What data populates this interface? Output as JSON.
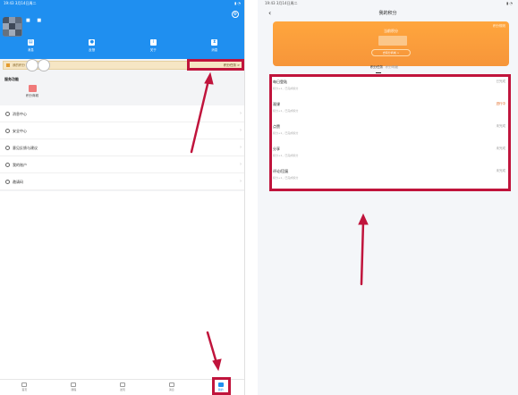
{
  "left": {
    "status": {
      "time": "19:43",
      "date": "3月14日周二"
    },
    "profile": {
      "name": "■ ■",
      "sub": ""
    },
    "quick": [
      {
        "label": "消息",
        "icon": "folder-icon"
      },
      {
        "label": "反馈",
        "icon": "chat-icon"
      },
      {
        "label": "关于",
        "icon": "info-icon"
      },
      {
        "label": "消息",
        "icon": "hourglass-icon"
      }
    ],
    "points_bar": {
      "text": "我的积分",
      "link": "积分任务 >"
    },
    "service_title": "服务功能",
    "service_item": "积分商城",
    "menu": [
      "消息中心",
      "安全中心",
      "意见反馈与建议",
      "我的账户",
      "邀请码"
    ],
    "tabs": [
      "首页",
      "课程",
      "发现",
      "消息",
      "我的"
    ],
    "active_tab": 4
  },
  "right": {
    "status": {
      "time": "19:43",
      "date": "3月14日周二"
    },
    "title": "我的积分",
    "card": {
      "rules_label": "积分规则",
      "title": "当前积分",
      "value": "",
      "button": "去积分商城 >"
    },
    "tabs": [
      "积分任务",
      "积分明细"
    ],
    "tasks": [
      {
        "name": "每日登陆",
        "desc": "积分+1，已完成积分",
        "status": "已完成",
        "active": false
      },
      {
        "name": "观课",
        "desc": "积分+1，已完成积分",
        "status": "进行中",
        "active": true
      },
      {
        "name": "点赞",
        "desc": "积分+1，已完成积分",
        "status": "未完成",
        "active": false
      },
      {
        "name": "分享",
        "desc": "积分+1，已完成积分",
        "status": "未完成",
        "active": false
      },
      {
        "name": "评论/回复",
        "desc": "积分+1，已完成积分",
        "status": "未完成",
        "active": false
      }
    ]
  },
  "colors": {
    "brand_blue": "#1f8ff0",
    "orange": "#f6953a",
    "highlight": "#c0143c"
  }
}
